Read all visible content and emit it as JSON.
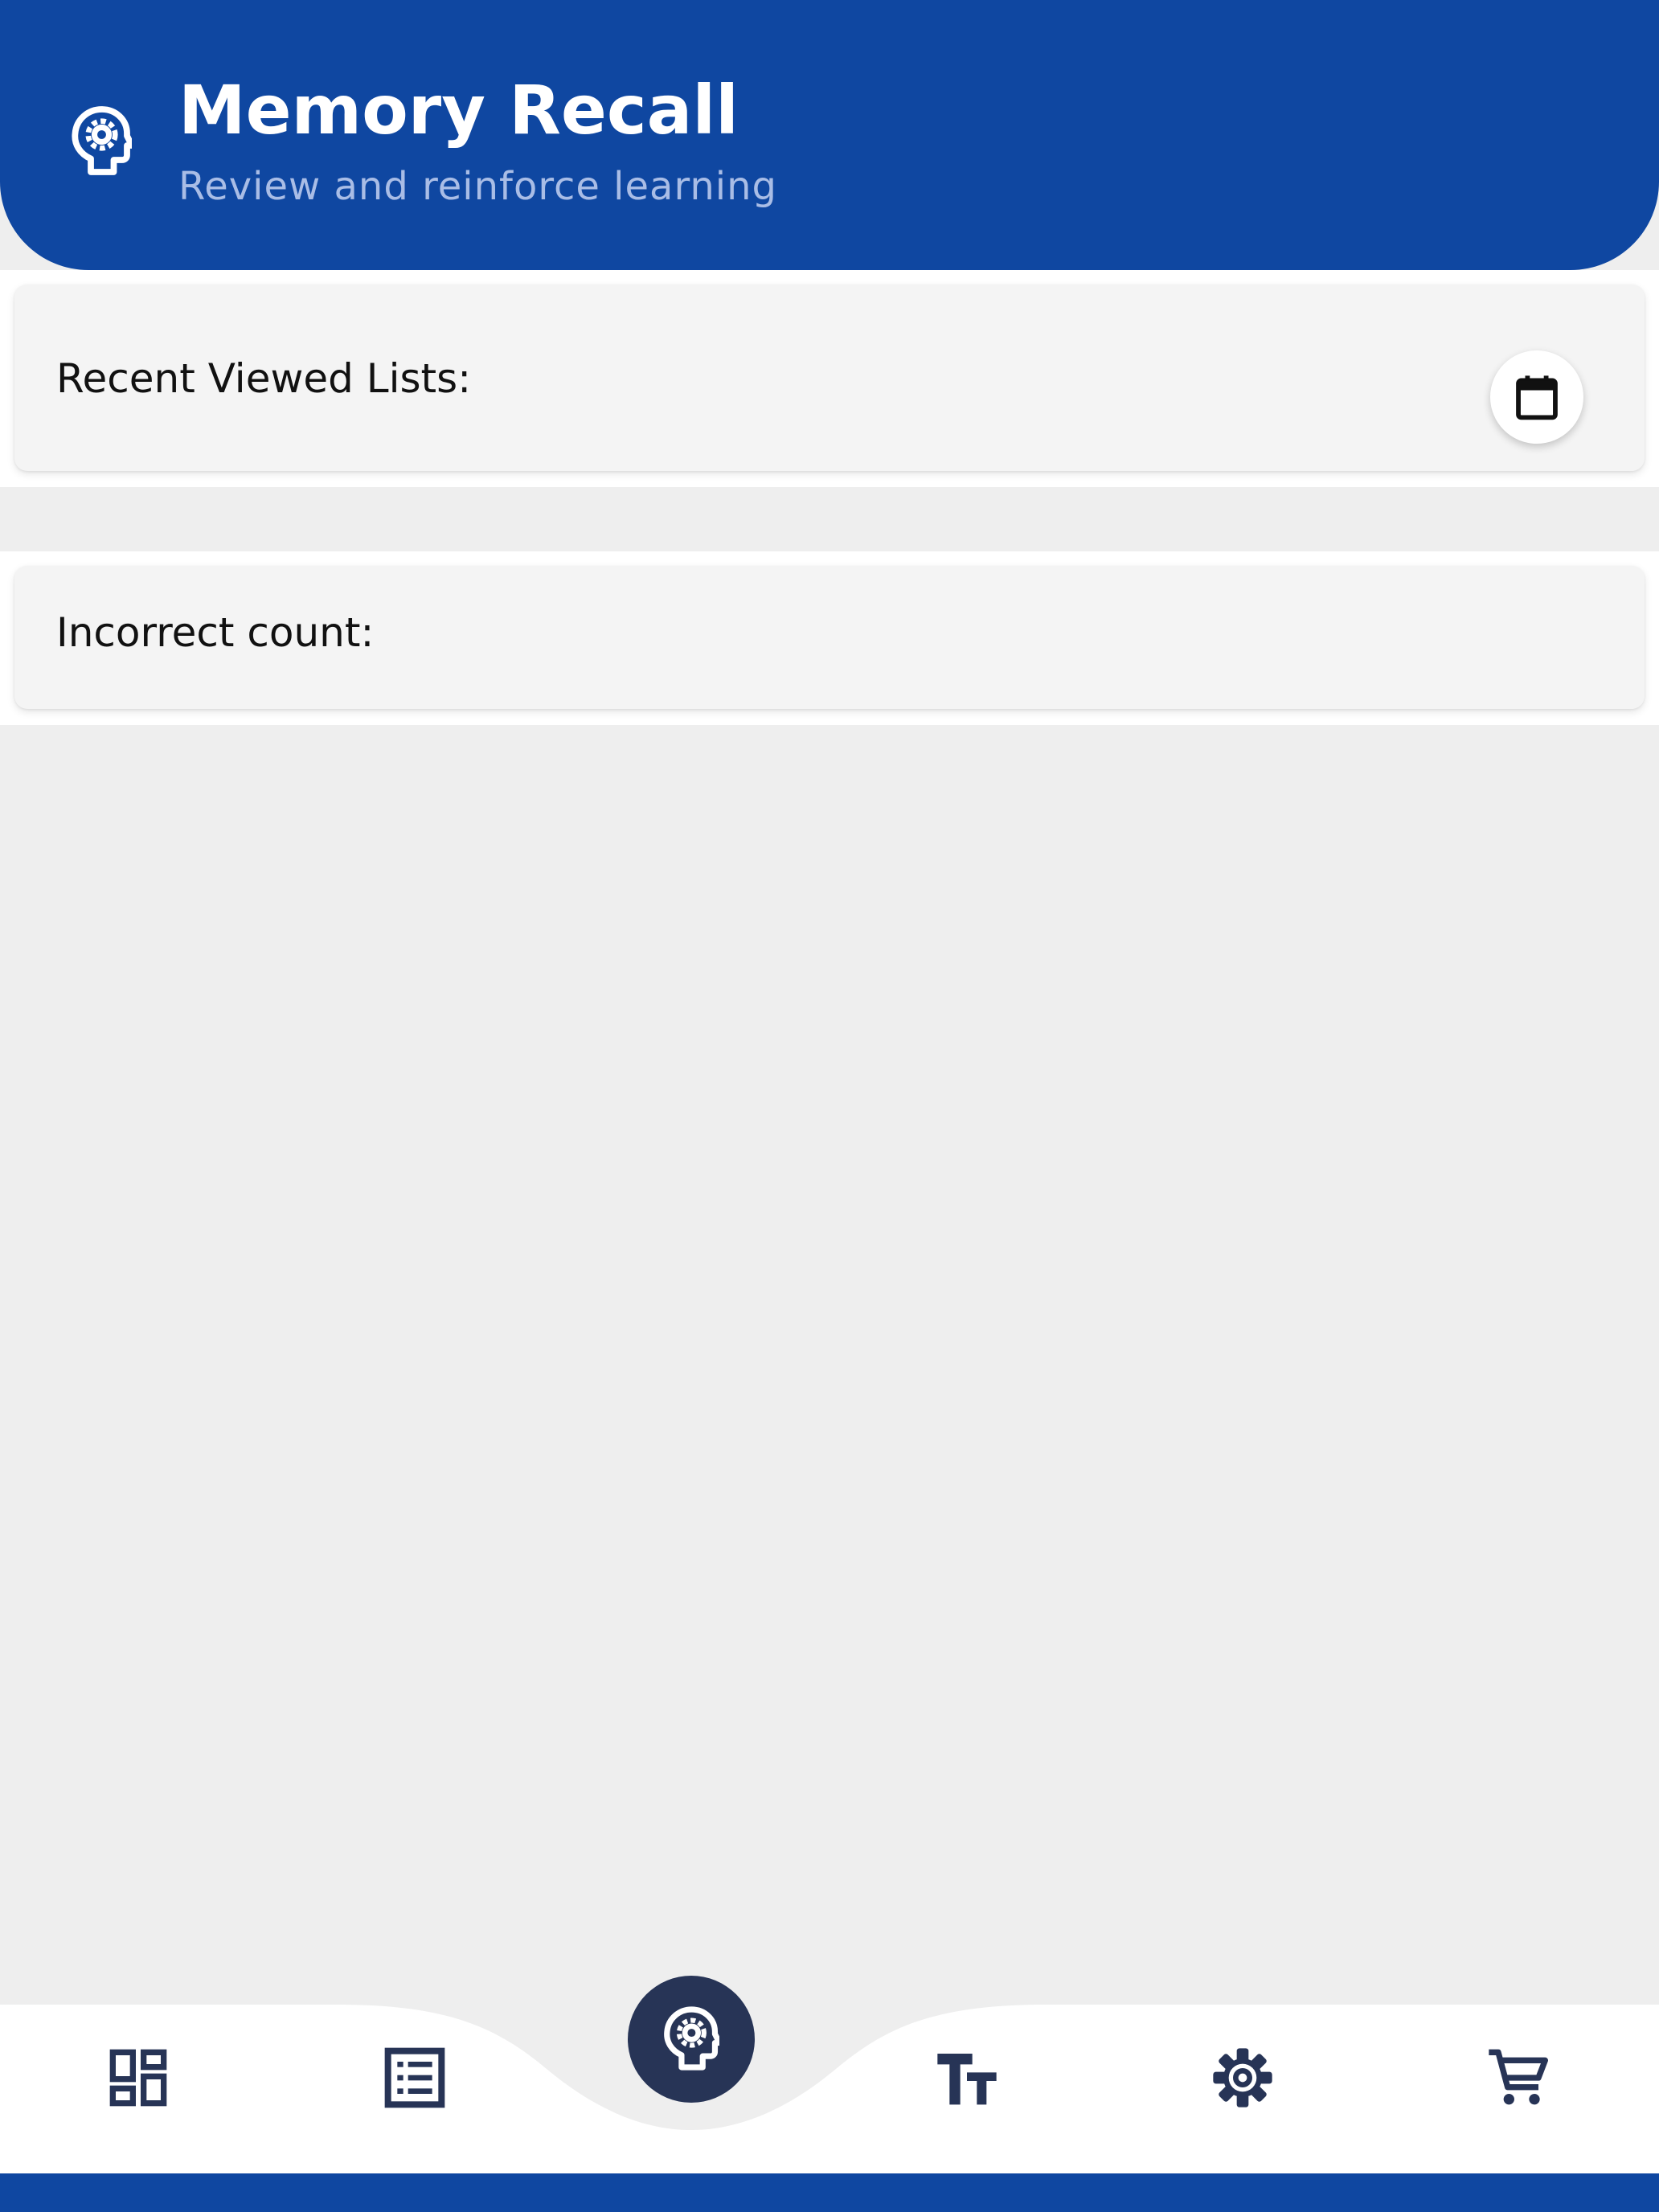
{
  "header": {
    "title": "Memory Recall",
    "subtitle": "Review and reinforce learning",
    "icon": "psychology-head-icon"
  },
  "recent_card": {
    "label": "Recent Viewed Lists:",
    "action_icon": "calendar-icon"
  },
  "incorrect_card": {
    "label": "Incorrect count:"
  },
  "bottom_nav": {
    "items": [
      {
        "icon": "dashboard-icon"
      },
      {
        "icon": "list-icon"
      },
      {
        "icon": "psychology-head-icon",
        "active": true
      },
      {
        "icon": "text-size-icon"
      },
      {
        "icon": "settings-gear-icon"
      },
      {
        "icon": "shopping-cart-icon"
      }
    ]
  },
  "colors": {
    "header_blue": "#0f47a1",
    "subtitle": "#a9bde6",
    "nav_icon": "#273456",
    "background": "#eeeeee",
    "card": "#f4f4f4"
  }
}
